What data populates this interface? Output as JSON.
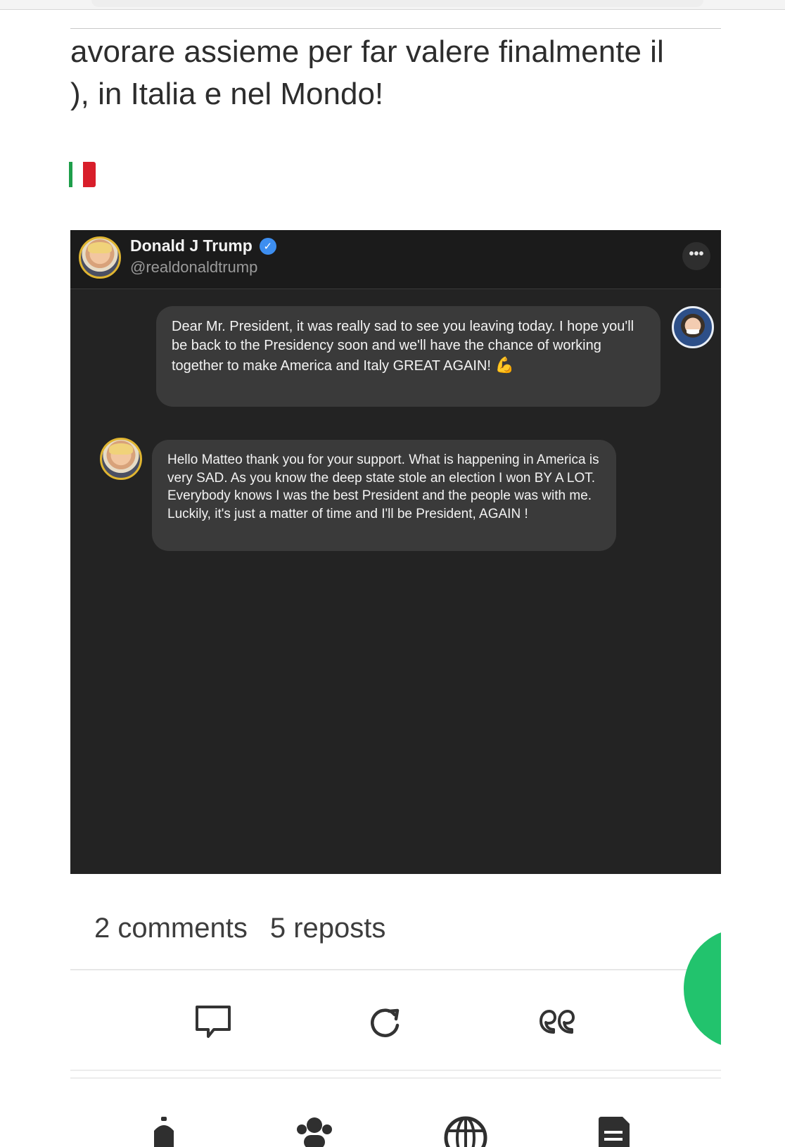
{
  "post": {
    "text_line1": "avorare assieme per far valere finalmente il",
    "text_line2": "), in Italia e nel Mondo!",
    "flag_icon": "italy-flag-icon"
  },
  "embed": {
    "author_name": "Donald J Trump",
    "author_handle": "@realdonaldtrump",
    "verified_icon": "verified-check-icon",
    "more_label": "•••",
    "messages": [
      {
        "sender": "outgoing",
        "text": "Dear Mr. President, it was really sad to see you leaving today. I hope you'll be back to the Presidency soon and we'll have the chance of working together to make America and Italy GREAT AGAIN!",
        "emoji": "💪"
      },
      {
        "sender": "incoming",
        "text": "Hello Matteo thank you for your support. What is happening in America is very SAD. As you know the deep state stole an election I won BY A LOT. Everybody knows I was the best President and the people was with me. Luckily, it's just a matter of time and I'll be President, AGAIN !"
      }
    ]
  },
  "stats": {
    "comments": "2 comments",
    "reposts": "5 reposts"
  },
  "actions": [
    "comment-icon",
    "repost-icon",
    "quote-icon"
  ],
  "tabbar": [
    "home-icon",
    "people-icon",
    "globe-icon",
    "documents-icon"
  ],
  "colors": {
    "embed_bg": "#232323",
    "bubble_bg": "#3a3a3a",
    "accent_green": "#22c36d",
    "verified_blue": "#3d8ef0"
  }
}
